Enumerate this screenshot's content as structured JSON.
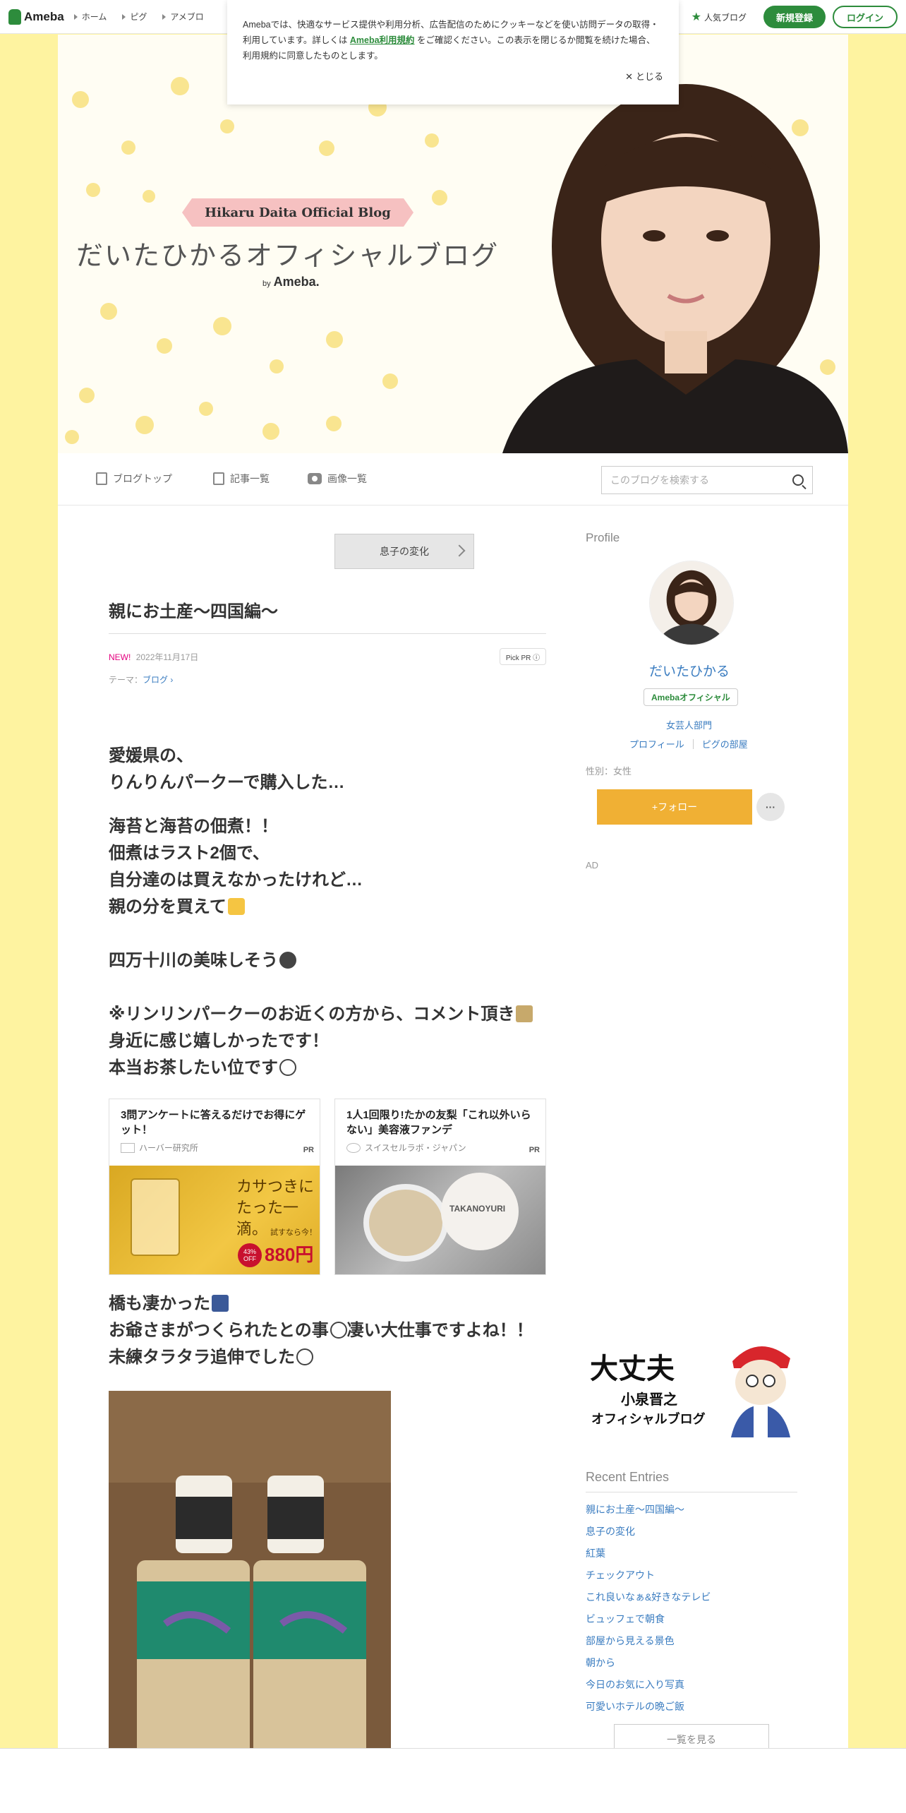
{
  "topnav": {
    "logo": "Ameba",
    "links": [
      "ホーム",
      "ピグ",
      "アメブロ"
    ],
    "popular_blog": "人気ブログ",
    "signup": "新規登録",
    "login": "ログイン"
  },
  "cookie": {
    "text_before": "Amebaでは、快適なサービス提供や利用分析、広告配信のためにクッキーなどを使い訪問データの取得・利用しています。詳しくは",
    "link": "Ameba利用規約",
    "text_after": "をご確認ください。この表示を閉じるか閲覧を続けた場合、利用規約に同意したものとします。",
    "close": "とじる"
  },
  "banner": {
    "ribbon": "Hikaru Daita Official Blog",
    "title": "だいたひかるオフィシャルブログ",
    "by": "by",
    "by_brand": "Ameba."
  },
  "subnav": {
    "top": "ブログトップ",
    "entries": "記事一覧",
    "images": "画像一覧",
    "search_placeholder": "このブログを検索する"
  },
  "article": {
    "prev_label": "息子の変化",
    "title": "親にお土産〜四国編〜",
    "new_label": "NEW!",
    "date": "2022年11月17日",
    "pick_pr": "Pick PR ⓘ",
    "theme_label": "テーマ：",
    "theme_value": "ブログ",
    "paragraphs": [
      [
        "愛媛県の、",
        "りんりんパークーで購入した…"
      ],
      [
        "海苔と海苔の佃煮！！",
        "佃煮はラスト2個で、",
        "自分達のは買えなかったけれど…",
        "親の分を買えて"
      ],
      [
        "四万十川の美味しそう"
      ],
      [
        "※リンリンパークーのお近くの方から、コメント頂き",
        "身近に感じ嬉しかったです！",
        "本当お茶したい位です"
      ],
      [
        "橋も凄かった",
        "お爺さまがつくられたとの事",
        "凄い大仕事ですよね！！",
        "未練タラタラ追伸でした"
      ]
    ]
  },
  "ads": [
    {
      "title": "3問アンケートに答えるだけでお得にゲット！",
      "sponsor": "ハーバー研究所",
      "pr": "PR",
      "copy": "カサつきに たった一滴。",
      "cta": "試すなら今！",
      "discount": "43% OFF",
      "price": "880円"
    },
    {
      "title": "1人1回限り!たかの友梨「これ以外いらない」美容液ファンデ",
      "sponsor": "スイスセルラボ・ジャパン",
      "pr": "PR",
      "product": "TAKANOYURI"
    }
  ],
  "sidebar": {
    "profile_heading": "Profile",
    "name": "だいたひかる",
    "badge": "Amebaオフィシャル",
    "category": "女芸人部門",
    "link_profile": "プロフィール",
    "link_pig": "ピグの部屋",
    "gender": "性別：女性",
    "follow": "+フォロー",
    "more": "···",
    "ad_label": "AD",
    "kid_ad_line1": "大丈夫",
    "kid_ad_line2": "小泉晋之",
    "kid_ad_line3": "オフィシャルブログ",
    "recent_heading": "Recent Entries",
    "recent": [
      "親にお土産〜四国編〜",
      "息子の変化",
      "紅葉",
      "チェックアウト",
      "これ良いなぁ&好きなテレビ",
      "ビュッフェで朝食",
      "部屋から見える景色",
      "朝から",
      "今日のお気に入り写真",
      "可愛いホテルの晩ご飯"
    ],
    "view_all": "一覧を見る"
  },
  "colors": {
    "brand_green": "#2d8c3c",
    "page_yellow": "#fef3a0",
    "follow_orange": "#f0b034",
    "link_blue": "#3a7cc0"
  }
}
